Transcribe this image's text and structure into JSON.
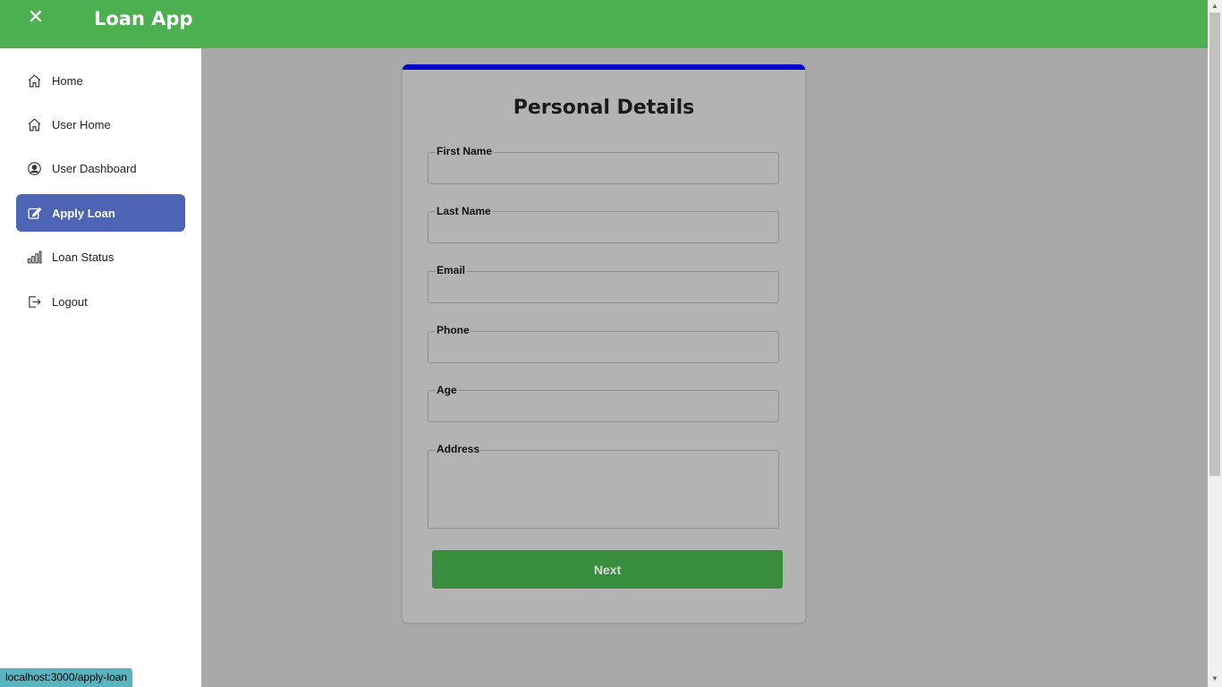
{
  "app": {
    "title": "Loan App",
    "close_icon": "close-icon",
    "header_color": "#4caf50"
  },
  "sidebar": {
    "items": [
      {
        "label": "Home",
        "icon": "home-icon",
        "active": false
      },
      {
        "label": "User Home",
        "icon": "home-icon",
        "active": false
      },
      {
        "label": "User Dashboard",
        "icon": "user-circle-icon",
        "active": false
      },
      {
        "label": "Apply Loan",
        "icon": "edit-icon",
        "active": true
      },
      {
        "label": "Loan Status",
        "icon": "bar-chart-icon",
        "active": false
      },
      {
        "label": "Logout",
        "icon": "logout-icon",
        "active": false
      }
    ],
    "active_color": "#4e65b5"
  },
  "form": {
    "title": "Personal Details",
    "fields": {
      "first_name": {
        "label": "First Name",
        "value": ""
      },
      "last_name": {
        "label": "Last Name",
        "value": ""
      },
      "email": {
        "label": "Email",
        "value": ""
      },
      "phone": {
        "label": "Phone",
        "value": ""
      },
      "age": {
        "label": "Age",
        "value": ""
      },
      "address": {
        "label": "Address",
        "value": ""
      }
    },
    "next_label": "Next",
    "accent_color": "#0000cc",
    "button_color": "#388e3c"
  },
  "status_bar": {
    "url": "localhost:3000/apply-loan"
  }
}
